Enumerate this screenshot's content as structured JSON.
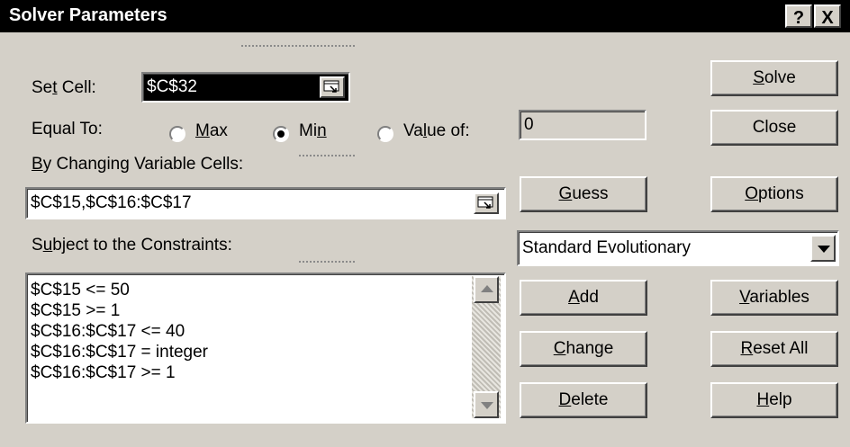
{
  "window": {
    "title": "Solver Parameters",
    "help_button": "?",
    "close_button": "X"
  },
  "set_cell": {
    "label_pre": "Se",
    "label_key": "t",
    "label_post": " Cell:",
    "value": "$C$32"
  },
  "equal_to": {
    "label": "Equal To:",
    "options": [
      {
        "pre": "",
        "key": "M",
        "post": "ax",
        "selected": false
      },
      {
        "pre": "Mi",
        "key": "n",
        "post": "",
        "selected": true
      },
      {
        "pre": "Va",
        "key": "l",
        "post": "ue of:",
        "selected": false
      }
    ],
    "value_of": "0"
  },
  "changing_cells": {
    "label_key": "B",
    "label_post": "y Changing Variable Cells:",
    "value": "$C$15,$C$16:$C$17"
  },
  "constraints": {
    "label_pre": "S",
    "label_key": "u",
    "label_post": "bject to the Constraints:",
    "items": [
      "$C$15 <= 50",
      "$C$15 >= 1",
      "$C$16:$C$17 <= 40",
      "$C$16:$C$17 = integer",
      "$C$16:$C$17 >= 1"
    ]
  },
  "engine": {
    "selected": "Standard Evolutionary"
  },
  "buttons": {
    "solve": {
      "pre": "",
      "key": "S",
      "post": "olve"
    },
    "close": {
      "label": "Close"
    },
    "guess": {
      "pre": "",
      "key": "G",
      "post": "uess"
    },
    "options": {
      "pre": "",
      "key": "O",
      "post": "ptions"
    },
    "add": {
      "pre": "",
      "key": "A",
      "post": "dd"
    },
    "variables": {
      "pre": "",
      "key": "V",
      "post": "ariables"
    },
    "change": {
      "pre": "",
      "key": "C",
      "post": "hange"
    },
    "reset_all": {
      "pre": "",
      "key": "R",
      "post": "eset All"
    },
    "delete": {
      "pre": "",
      "key": "D",
      "post": "elete"
    },
    "help": {
      "pre": "",
      "key": "H",
      "post": "elp"
    }
  }
}
